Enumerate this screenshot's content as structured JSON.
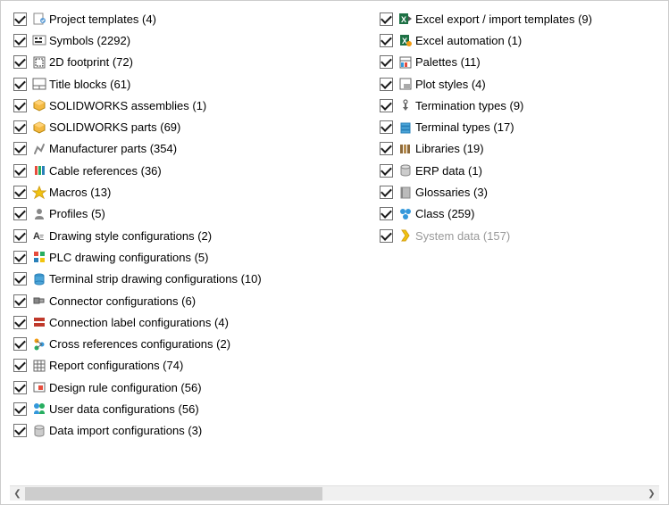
{
  "left_column": [
    {
      "label": "Project templates (4)",
      "checked": true,
      "icon": "project-template-icon",
      "disabled": false
    },
    {
      "label": "Symbols (2292)",
      "checked": true,
      "icon": "symbols-icon",
      "disabled": false
    },
    {
      "label": "2D footprint (72)",
      "checked": true,
      "icon": "footprint-icon",
      "disabled": false
    },
    {
      "label": "Title blocks (61)",
      "checked": true,
      "icon": "title-block-icon",
      "disabled": false
    },
    {
      "label": "SOLIDWORKS assemblies (1)",
      "checked": true,
      "icon": "sw-assembly-icon",
      "disabled": false
    },
    {
      "label": "SOLIDWORKS parts (69)",
      "checked": true,
      "icon": "sw-part-icon",
      "disabled": false
    },
    {
      "label": "Manufacturer parts (354)",
      "checked": true,
      "icon": "manufacturer-icon",
      "disabled": false
    },
    {
      "label": "Cable references (36)",
      "checked": true,
      "icon": "cable-icon",
      "disabled": false
    },
    {
      "label": "Macros (13)",
      "checked": true,
      "icon": "macro-icon",
      "disabled": false
    },
    {
      "label": "Profiles (5)",
      "checked": true,
      "icon": "profile-icon",
      "disabled": false
    },
    {
      "label": "Drawing style configurations (2)",
      "checked": true,
      "icon": "drawing-style-icon",
      "disabled": false
    },
    {
      "label": "PLC drawing configurations (5)",
      "checked": true,
      "icon": "plc-icon",
      "disabled": false
    },
    {
      "label": "Terminal strip drawing configurations (10)",
      "checked": true,
      "icon": "terminal-strip-icon",
      "disabled": false
    },
    {
      "label": "Connector configurations (6)",
      "checked": true,
      "icon": "connector-icon",
      "disabled": false
    },
    {
      "label": "Connection label configurations (4)",
      "checked": true,
      "icon": "connection-label-icon",
      "disabled": false
    },
    {
      "label": "Cross references configurations (2)",
      "checked": true,
      "icon": "cross-ref-icon",
      "disabled": false
    },
    {
      "label": "Report configurations (74)",
      "checked": true,
      "icon": "report-icon",
      "disabled": false
    },
    {
      "label": "Design rule configuration (56)",
      "checked": true,
      "icon": "design-rule-icon",
      "disabled": false
    },
    {
      "label": "User data configurations (56)",
      "checked": true,
      "icon": "user-data-icon",
      "disabled": false
    },
    {
      "label": "Data import configurations (3)",
      "checked": true,
      "icon": "data-import-icon",
      "disabled": false
    }
  ],
  "right_column": [
    {
      "label": "Excel export / import templates (9)",
      "checked": true,
      "icon": "excel-export-icon",
      "disabled": false
    },
    {
      "label": "Excel automation (1)",
      "checked": true,
      "icon": "excel-auto-icon",
      "disabled": false
    },
    {
      "label": "Palettes (11)",
      "checked": true,
      "icon": "palette-icon",
      "disabled": false
    },
    {
      "label": "Plot styles (4)",
      "checked": true,
      "icon": "plot-style-icon",
      "disabled": false
    },
    {
      "label": "Termination types (9)",
      "checked": true,
      "icon": "termination-icon",
      "disabled": false
    },
    {
      "label": "Terminal types (17)",
      "checked": true,
      "icon": "terminal-type-icon",
      "disabled": false
    },
    {
      "label": "Libraries (19)",
      "checked": true,
      "icon": "library-icon",
      "disabled": false
    },
    {
      "label": "ERP data (1)",
      "checked": true,
      "icon": "erp-icon",
      "disabled": false
    },
    {
      "label": "Glossaries (3)",
      "checked": true,
      "icon": "glossary-icon",
      "disabled": false
    },
    {
      "label": "Class (259)",
      "checked": true,
      "icon": "class-icon",
      "disabled": false
    },
    {
      "label": "System data (157)",
      "checked": true,
      "icon": "system-data-icon",
      "disabled": true
    }
  ]
}
